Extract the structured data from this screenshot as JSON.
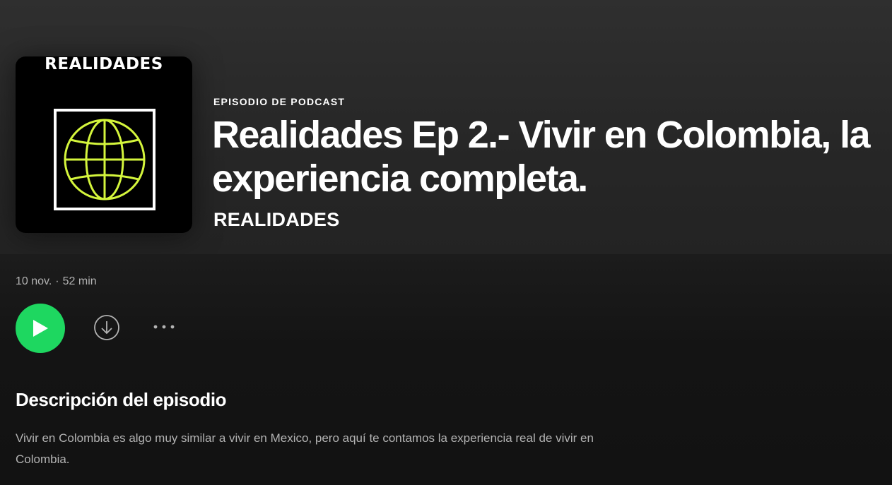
{
  "cover": {
    "title": "REALIDADES",
    "globe_color": "#d4f53c",
    "icon": "globe-icon"
  },
  "episode": {
    "type_label": "EPISODIO DE PODCAST",
    "title": "Realidades Ep 2.- Vivir en Colombia, la experiencia completa.",
    "show": "REALIDADES",
    "date": "10 nov.",
    "separator": "·",
    "duration": "52 min"
  },
  "actions": {
    "play_icon": "play-icon",
    "download_icon": "download-icon",
    "more_icon": "more-options-icon"
  },
  "description": {
    "heading": "Descripción del episodio",
    "text": "Vivir en Colombia es algo muy similar a vivir en Mexico, pero aquí te contamos la experiencia real de vivir en Colombia."
  },
  "colors": {
    "accent": "#1ed760",
    "background": "#121212",
    "secondary_text": "#b3b3b3"
  }
}
